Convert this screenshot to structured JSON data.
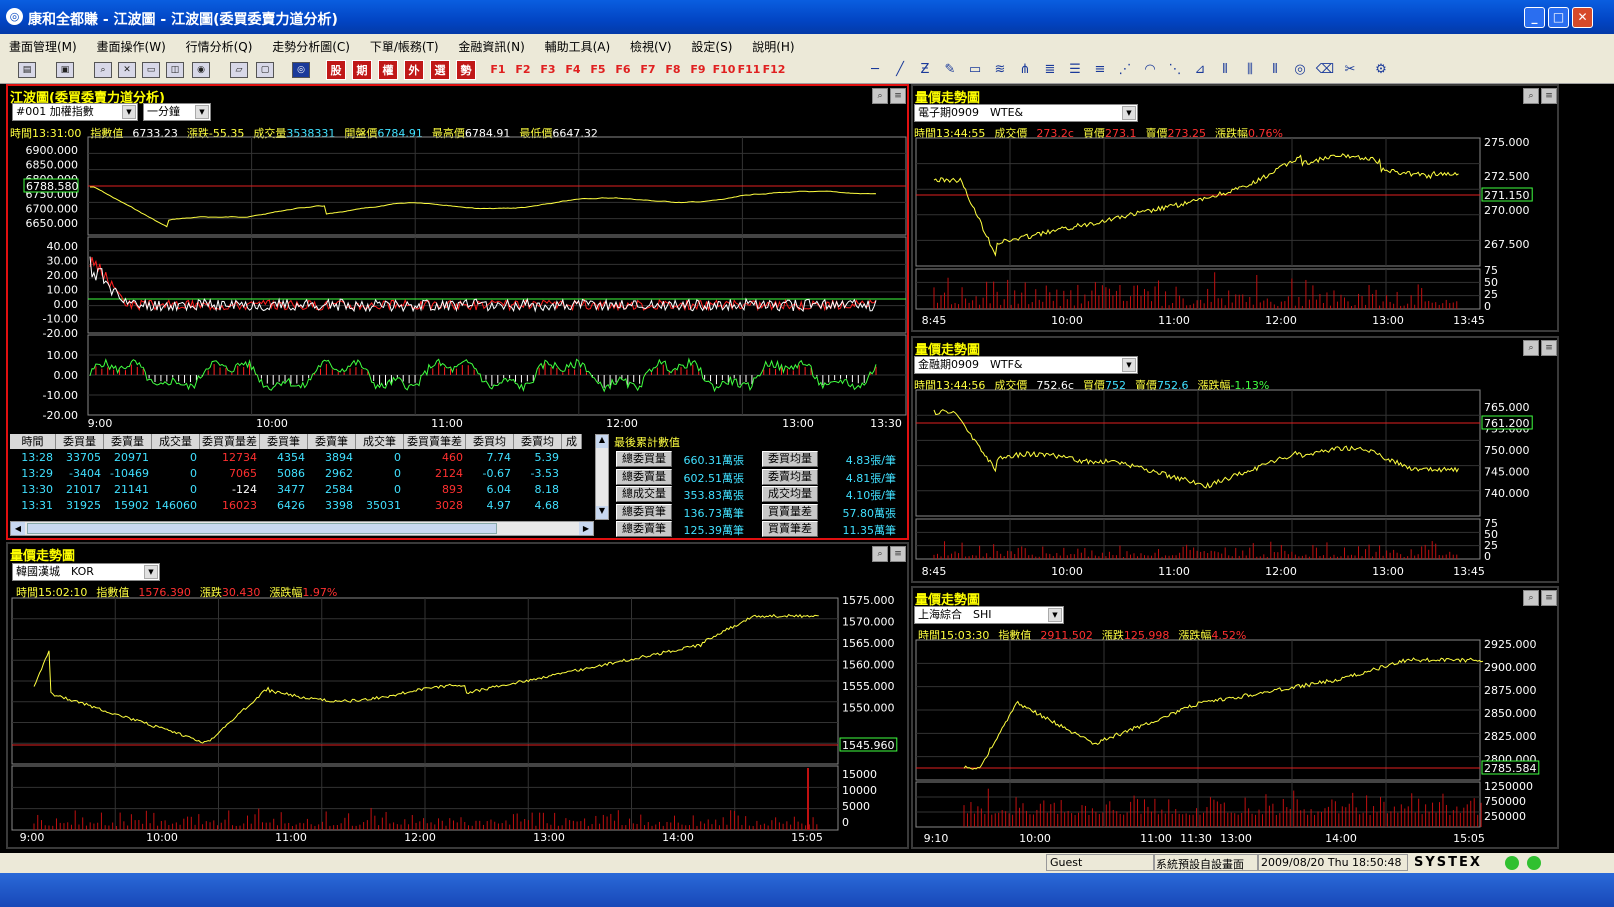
{
  "window": {
    "title": "康和全都賺 - 江波圖 - 江波圖(委買委賣力道分析)"
  },
  "menu": [
    "畫面管理(M)",
    "畫面操作(W)",
    "行情分析(Q)",
    "走勢分析圖(C)",
    "下單/帳務(T)",
    "金融資訊(N)",
    "輔助工具(A)",
    "檢視(V)",
    "設定(S)",
    "說明(H)"
  ],
  "toolbar": {
    "red_buttons": [
      "股",
      "期",
      "權",
      "外",
      "選",
      "勢"
    ],
    "function_keys": [
      "F1",
      "F2",
      "F3",
      "F4",
      "F5",
      "F6",
      "F7",
      "F8",
      "F9",
      "F10",
      "F11",
      "F12"
    ]
  },
  "main": {
    "title": "江波圖(委買委賣力道分析)",
    "symbol": "#001 加權指數",
    "period": "一分鐘",
    "info": {
      "time": "時間13:31:00",
      "index_label": "指數值",
      "index_val": "6733.23",
      "change": "漲跌-55.35",
      "vol_label": "成交量",
      "vol": "3538331",
      "open_label": "開盤價",
      "open": "6784.91",
      "high_label": "最高價",
      "high": "6784.91",
      "low_label": "最低價",
      "low": "6647.32"
    },
    "price_ticks": [
      "6900.000",
      "6850.000",
      "6800.000",
      "6750.000",
      "6700.000",
      "6650.000"
    ],
    "price_ref": "6788.580",
    "osc1_ticks": [
      "40.00",
      "30.00",
      "20.00",
      "10.00",
      "0.00",
      "-10.00",
      "-20.00"
    ],
    "osc2_ticks": [
      "10.00",
      "0.00",
      "-10.00",
      "-20.00"
    ],
    "xticks": [
      "9:00",
      "10:00",
      "11:00",
      "12:00",
      "13:00",
      "13:30"
    ],
    "table": {
      "headers": [
        "時間",
        "委買量",
        "委賣量",
        "成交量",
        "委買賣量差",
        "委買筆",
        "委賣筆",
        "成交筆",
        "委買賣筆差",
        "委買均",
        "委賣均",
        "成"
      ],
      "rows": [
        [
          "13:28",
          "33705",
          "20971",
          "0",
          "12734",
          "4354",
          "3894",
          "0",
          "460",
          "7.74",
          "5.39"
        ],
        [
          "13:29",
          "-3404",
          "-10469",
          "0",
          "7065",
          "5086",
          "2962",
          "0",
          "2124",
          "-0.67",
          "-3.53"
        ],
        [
          "13:30",
          "21017",
          "21141",
          "0",
          "-124",
          "3477",
          "2584",
          "0",
          "893",
          "6.04",
          "8.18"
        ],
        [
          "13:31",
          "31925",
          "15902",
          "146060",
          "16023",
          "6426",
          "3398",
          "35031",
          "3028",
          "4.97",
          "4.68"
        ]
      ]
    },
    "summary": {
      "title": "最後累計數值",
      "items": [
        {
          "label": "總委買量",
          "value": "660.31萬張",
          "label2": "委買均量",
          "value2": "4.83張/筆"
        },
        {
          "label": "總委賣量",
          "value": "602.51萬張",
          "label2": "委賣均量",
          "value2": "4.81張/筆"
        },
        {
          "label": "總成交量",
          "value": "353.83萬張",
          "label2": "成交均量",
          "value2": "4.10張/筆"
        },
        {
          "label": "總委買筆",
          "value": "136.73萬筆",
          "label2": "買賣量差",
          "value2": "57.80萬張"
        },
        {
          "label": "總委賣筆",
          "value": "125.39萬筆",
          "label2": "買賣筆差",
          "value2": "11.35萬筆"
        }
      ]
    }
  },
  "panels": {
    "korea": {
      "title": "量價走勢圖",
      "symbol": "韓國漢城　KOR",
      "time": "時間15:02:10",
      "idx_label": "指數值",
      "idx": "1576.390",
      "chg_label": "漲跌",
      "chg": "30.430",
      "pct_label": "漲跌幅",
      "pct": "1.97%",
      "yticks": [
        "1575.000",
        "1570.000",
        "1565.000",
        "1560.000",
        "1555.000",
        "1550.000"
      ],
      "ref": "1545.960",
      "vticks": [
        "15000",
        "10000",
        "5000",
        "0"
      ],
      "xticks": [
        "9:00",
        "10:00",
        "11:00",
        "12:00",
        "13:00",
        "14:00",
        "15:05"
      ]
    },
    "elec": {
      "title": "量價走勢圖",
      "symbol": "電子期0909　WTE&",
      "time": "時間13:44:55",
      "px_label": "成交價",
      "px": "273.2c",
      "bid_label": "買價",
      "bid": "273.1",
      "ask_label": "賣價",
      "ask": "273.25",
      "pct_label": "漲跌幅",
      "pct": "0.76%",
      "yticks": [
        "275.000",
        "272.500",
        "270.000",
        "267.500"
      ],
      "ref": "271.150",
      "vticks": [
        "75",
        "50",
        "25",
        "0"
      ],
      "xticks": [
        "8:45",
        "10:00",
        "11:00",
        "12:00",
        "13:00",
        "13:45"
      ]
    },
    "fin": {
      "title": "量價走勢圖",
      "symbol": "金融期0909　WTF&",
      "time": "時間13:44:56",
      "px_label": "成交價",
      "px": "752.6c",
      "bid_label": "買價",
      "bid": "752",
      "ask_label": "賣價",
      "ask": "752.6",
      "pct_label": "漲跌幅",
      "pct": "-1.13%",
      "yticks": [
        "765.000",
        "755.000",
        "750.000",
        "745.000",
        "740.000"
      ],
      "ref": "761.200",
      "vticks": [
        "75",
        "50",
        "25",
        "0"
      ],
      "xticks": [
        "8:45",
        "10:00",
        "11:00",
        "12:00",
        "13:00",
        "13:45"
      ]
    },
    "sh": {
      "title": "量價走勢圖",
      "symbol": "上海綜合　SHI",
      "time": "時間15:03:30",
      "idx_label": "指數值",
      "idx": "2911.502",
      "chg_label": "漲跌",
      "chg": "125.998",
      "pct_label": "漲跌幅",
      "pct": "4.52%",
      "yticks": [
        "2925.000",
        "2900.000",
        "2875.000",
        "2850.000",
        "2825.000",
        "2800.000"
      ],
      "ref": "2785.584",
      "vticks": [
        "1250000",
        "750000",
        "250000"
      ],
      "xticks": [
        "9:10",
        "10:00",
        "11:00",
        "11:30",
        "13:00",
        "14:00",
        "15:05"
      ]
    }
  },
  "status": {
    "user": "Guest",
    "layout": "系統預設自設畫面",
    "datetime": "2009/08/20 Thu 18:50:48",
    "brand": "SYSTEX"
  },
  "colors": {
    "accent_border": "#e01010",
    "price_line": "#ffff40",
    "ref_line": "#e02020",
    "volume": "#c01010",
    "osc_green": "#40ff40",
    "osc_red": "#ff2020"
  }
}
